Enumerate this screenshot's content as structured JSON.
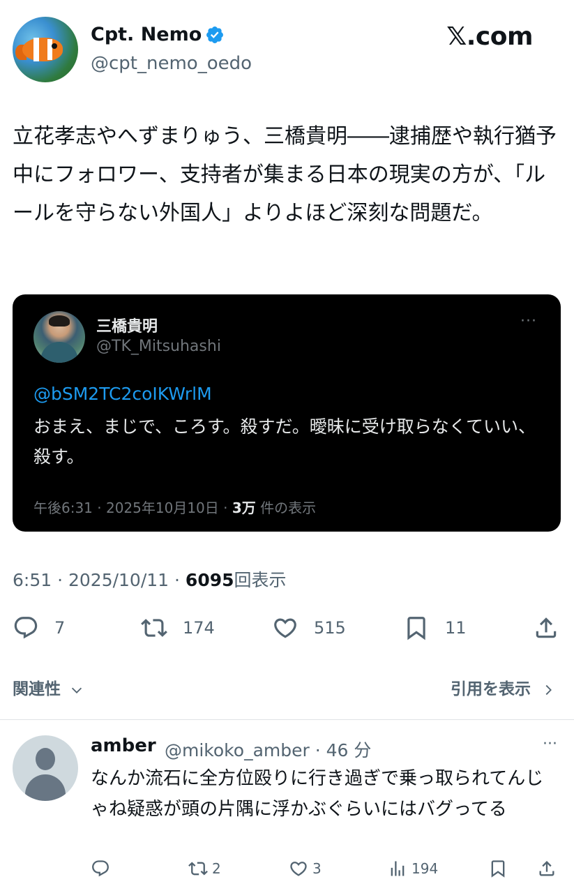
{
  "author": {
    "name": "Cpt. Nemo",
    "handle": "@cpt_nemo_oedo",
    "verified": true
  },
  "brand": "𝕏.com",
  "tweet": {
    "text": "立花孝志やへずまりゅう、三橋貴明――逮捕歴や執行猶予中にフォロワー、支持者が集まる日本の現実の方が、「ルールを守らない外国人」よりよほど深刻な問題だ。"
  },
  "quote": {
    "name": "三橋貴明",
    "handle": "@TK_Mitsuhashi",
    "more": "···",
    "mention": "@bSM2TC2coIKWrlM",
    "text": "おまえ、まじで、ころす。殺すだ。曖昧に受け取らなくていい、殺す。",
    "time": "午後6:31 · 2025年10月10日 · ",
    "views_count": "3万",
    "views_label": " 件の表示"
  },
  "meta": {
    "time": "6:51 · 2025/10/11 · ",
    "views_count": "6095",
    "views_label": "回表示"
  },
  "actions": {
    "replies": "7",
    "reposts": "174",
    "likes": "515",
    "bookmarks": "11"
  },
  "related_label": "関連性",
  "quotes_link_label": "引用を表示",
  "reply": {
    "name": "amber",
    "handle": "@mikoko_amber · 46 分",
    "more": "···",
    "text": "なんか流石に全方位殴りに行き過ぎで乗っ取られてんじゃね疑惑が頭の片隅に浮かぶぐらいにはバグってる",
    "reposts": "2",
    "likes": "3",
    "views": "194"
  },
  "colors": {
    "accent": "#1d9bf0",
    "text": "#0f1419",
    "muted": "#536471"
  }
}
